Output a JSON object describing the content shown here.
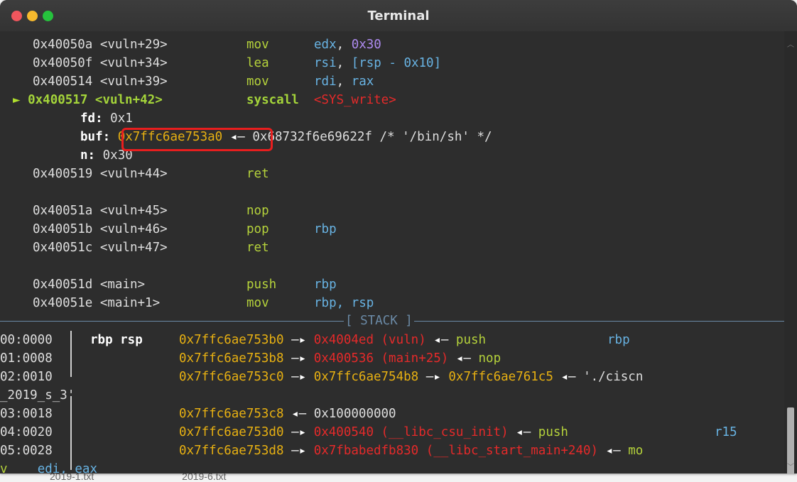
{
  "window": {
    "title": "Terminal"
  },
  "under_window": [
    "2019-1.txt",
    "2019-6.txt"
  ],
  "disasm": [
    {
      "addr": "0x40050a <vuln+29>",
      "mnem": "mov",
      "op1": "edx",
      "sep": ", ",
      "op2": "0x30"
    },
    {
      "addr": "0x40050f <vuln+34>",
      "mnem": "lea",
      "op1": "rsi",
      "sep": ", ",
      "op2": "[rsp - 0x10]"
    },
    {
      "addr": "0x400514 <vuln+39>",
      "mnem": "mov",
      "op1": "rdi",
      "sep": ", ",
      "op2": "rax"
    }
  ],
  "current": {
    "marker": "►",
    "addr": "0x400517 <vuln+42>",
    "mnem": "syscall",
    "sym": "<SYS_write>"
  },
  "syscall_args": {
    "fd_label": "fd:",
    "fd_value": "0x1",
    "buf_label": "buf:",
    "buf_value": "0x7ffc6ae753a0",
    "buf_arrow": "◂—",
    "buf_target": "0x68732f6e69622f /* '/bin/sh' */",
    "n_label": "n:",
    "n_value": "0x30"
  },
  "disasm2": [
    {
      "addr": "0x400519 <vuln+44>",
      "mnem": "ret",
      "op": ""
    },
    {
      "addr": "0x40051a <vuln+45>",
      "mnem": "nop",
      "op": ""
    },
    {
      "addr": "0x40051b <vuln+46>",
      "mnem": "pop",
      "op": "rbp"
    },
    {
      "addr": "0x40051c <vuln+47>",
      "mnem": "ret",
      "op": ""
    },
    {
      "addr": "0x40051d <main>",
      "mnem": "push",
      "op": "rbp"
    },
    {
      "addr": "0x40051e <main+1>",
      "mnem": "mov",
      "op": "rbp, rsp"
    }
  ],
  "stack_header": "[ STACK ]",
  "stack": {
    "r0": {
      "idx": "00:0000",
      "regs": "rbp rsp",
      "addr": "0x7ffc6ae753b0",
      "a1": "—▸",
      "val": "0x4004ed (vuln)",
      "a2": "◂—",
      "insn": "push",
      "op": "rbp"
    },
    "r1": {
      "idx": "01:0008",
      "addr": "0x7ffc6ae753b8",
      "a1": "—▸",
      "val": "0x400536 (main+25)",
      "a2": "◂—",
      "insn": "nop"
    },
    "r2": {
      "idx": "02:0010",
      "addr": "0x7ffc6ae753c0",
      "a1": "—▸",
      "v1": "0x7ffc6ae754b8",
      "a2": "—▸",
      "v2": "0x7ffc6ae761c5",
      "a3": "◂—",
      "str": "'./ciscn",
      "wrap": "_2019_s_3'"
    },
    "r3": {
      "idx": "03:0018",
      "addr": "0x7ffc6ae753c8",
      "a1": "◂—",
      "val": "0x100000000"
    },
    "r4": {
      "idx": "04:0020",
      "addr": "0x7ffc6ae753d0",
      "a1": "—▸",
      "val": "0x400540 (__libc_csu_init)",
      "a2": "◂—",
      "insn": "push",
      "op": "r15"
    },
    "r5": {
      "idx": "05:0028",
      "addr": "0x7ffc6ae753d8",
      "a1": "—▸",
      "val": "0x7fbabedfb830 (__libc_start_main+240)",
      "a2": "◂—",
      "insn": "mo",
      "wrap_insn": "v",
      "wrap_ops": "edi, eax"
    }
  },
  "colors": {
    "window_bg": "#2d2d2d",
    "address_yellow": "#e7b012",
    "code_red": "#e52a2a",
    "register_cyan": "#68b3e3",
    "mnemonic_green": "#b5d23b",
    "immediate_purple": "#ae8bf0",
    "highlight_box": "#e81e1e"
  },
  "icons": [
    "close-icon",
    "minimize-icon",
    "maximize-icon",
    "current-instruction-arrow-icon",
    "scroll-up-icon",
    "scroll-down-icon"
  ]
}
